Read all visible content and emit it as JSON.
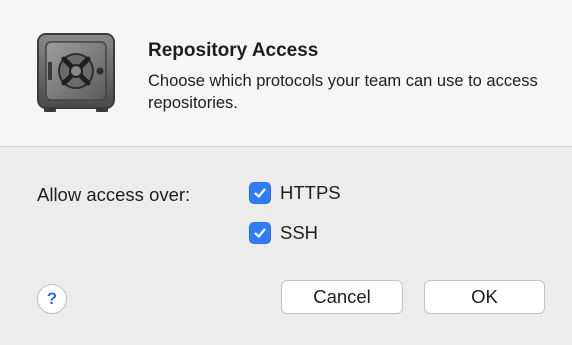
{
  "dialog": {
    "title": "Repository Access",
    "description": "Choose which protocols your team can use to access repositories.",
    "icon": "vault-icon"
  },
  "access": {
    "label": "Allow access over:",
    "options": [
      {
        "label": "HTTPS",
        "checked": true
      },
      {
        "label": "SSH",
        "checked": true
      }
    ]
  },
  "buttons": {
    "help": "?",
    "cancel": "Cancel",
    "ok": "OK"
  },
  "colors": {
    "accent": "#2f7cf6",
    "background": "#ececec",
    "header_background": "#f6f6f6"
  }
}
